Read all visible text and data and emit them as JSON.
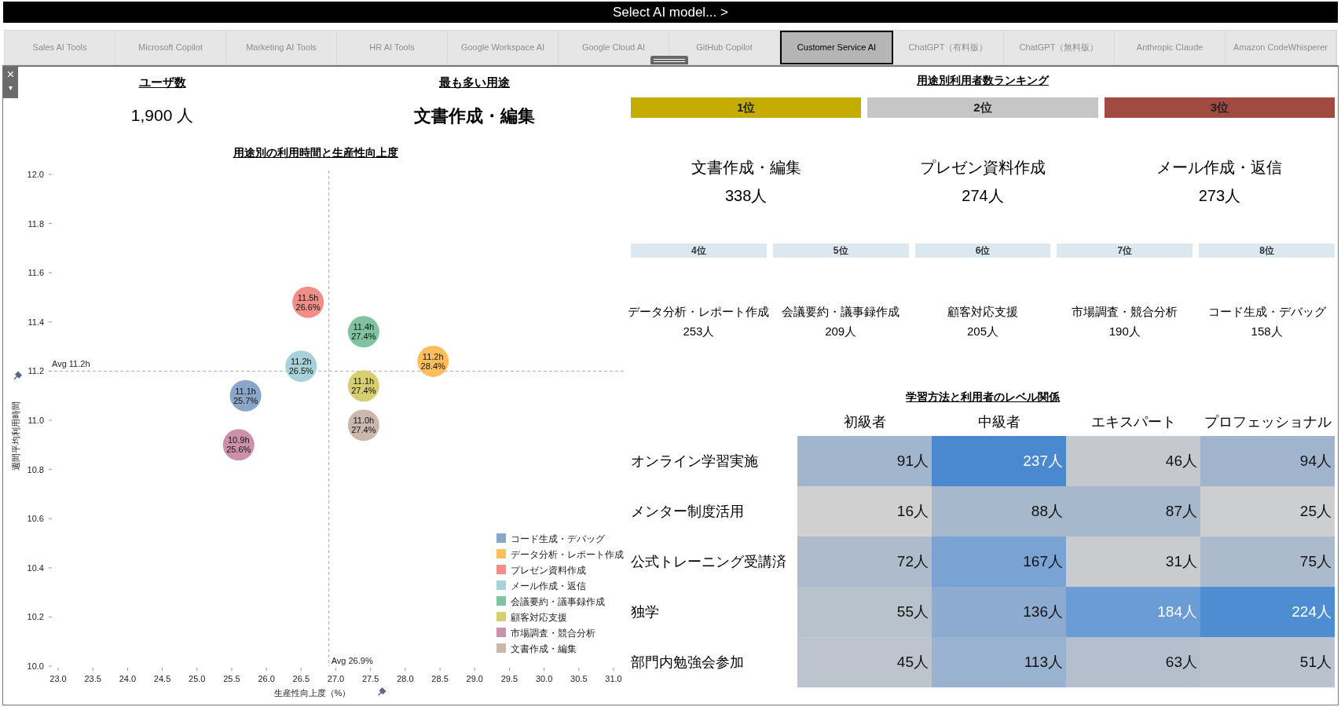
{
  "header": {
    "title": "Select AI model... >"
  },
  "tabs": [
    {
      "label": "Sales AI Tools",
      "selected": false
    },
    {
      "label": "Microsoft Copilot",
      "selected": false
    },
    {
      "label": "Marketing AI Tools",
      "selected": false
    },
    {
      "label": "HR AI Tools",
      "selected": false
    },
    {
      "label": "Google Workspace AI",
      "selected": false
    },
    {
      "label": "Google Cloud AI",
      "selected": false
    },
    {
      "label": "GitHub Copilot",
      "selected": false
    },
    {
      "label": "Customer Service AI",
      "selected": true
    },
    {
      "label": "ChatGPT（有料版）",
      "selected": false
    },
    {
      "label": "ChatGPT（無料版）",
      "selected": false
    },
    {
      "label": "Anthropic Claude",
      "selected": false
    },
    {
      "label": "Amazon CodeWhisperer",
      "selected": false
    }
  ],
  "close_button": {
    "label": "×",
    "menu": "▾"
  },
  "kpis": [
    {
      "label": "ユーザ数",
      "value": "1,900 人",
      "bold": false
    },
    {
      "label": "最も多い用途",
      "value": "文書作成・編集",
      "bold": true
    }
  ],
  "scatter": {
    "title": "用途別の利用時間と生産性向上度",
    "chart_data": {
      "type": "scatter",
      "xlabel": "生産性向上度（%）",
      "ylabel": "週間平均利用時間",
      "xlim": [
        23,
        31
      ],
      "ylim": [
        10,
        12
      ],
      "xticks": [
        {
          "value": 23,
          "label": "23.0"
        },
        {
          "value": 23.5,
          "label": "23.5"
        },
        {
          "value": 24,
          "label": "24.0"
        },
        {
          "value": 24.5,
          "label": "24.5"
        },
        {
          "value": 25,
          "label": "25.0"
        },
        {
          "value": 25.5,
          "label": "25.5"
        },
        {
          "value": 26,
          "label": "26.0"
        },
        {
          "value": 26.5,
          "label": "26.5"
        },
        {
          "value": 27,
          "label": "27.0"
        },
        {
          "value": 27.5,
          "label": "27.5"
        },
        {
          "value": 28,
          "label": "28.0"
        },
        {
          "value": 28.5,
          "label": "28.5"
        },
        {
          "value": 29,
          "label": "29.0"
        },
        {
          "value": 29.5,
          "label": "29.5"
        },
        {
          "value": 30,
          "label": "30.0"
        },
        {
          "value": 30.5,
          "label": "30.5"
        },
        {
          "value": 31,
          "label": "31.0"
        }
      ],
      "yticks": [
        {
          "value": 10,
          "label": "10.0"
        },
        {
          "value": 10.2,
          "label": "10.2"
        },
        {
          "value": 10.4,
          "label": "10.4"
        },
        {
          "value": 10.6,
          "label": "10.6"
        },
        {
          "value": 10.8,
          "label": "10.8"
        },
        {
          "value": 11,
          "label": "11.0"
        },
        {
          "value": 11.2,
          "label": "11.2"
        },
        {
          "value": 11.4,
          "label": "11.4"
        },
        {
          "value": 11.6,
          "label": "11.6"
        },
        {
          "value": 11.8,
          "label": "11.8"
        },
        {
          "value": 12,
          "label": "12.0"
        }
      ],
      "series": [
        {
          "name": "コード生成・デバッグ",
          "color": "#8aa6c9",
          "x": [
            25.7
          ],
          "values": [
            11.1
          ],
          "value_labels": [
            "11.1h\n25.7%"
          ]
        },
        {
          "name": "データ分析・レポート作成",
          "color": "#ffbe5e",
          "x": [
            28.4
          ],
          "values": [
            11.24
          ],
          "value_labels": [
            "11.2h\n28.4%"
          ]
        },
        {
          "name": "プレゼン資料作成",
          "color": "#f28e88",
          "x": [
            26.6
          ],
          "values": [
            11.48
          ],
          "value_labels": [
            "11.5h\n26.6%"
          ]
        },
        {
          "name": "メール作成・返信",
          "color": "#a8d1d9",
          "x": [
            26.5
          ],
          "values": [
            11.22
          ],
          "value_labels": [
            "11.2h\n26.5%"
          ]
        },
        {
          "name": "会議要約・議事録作成",
          "color": "#80c3a0",
          "x": [
            27.4
          ],
          "values": [
            11.36
          ],
          "value_labels": [
            "11.4h\n27.4%"
          ]
        },
        {
          "name": "顧客対応支援",
          "color": "#d5cf70",
          "x": [
            27.4
          ],
          "values": [
            11.14
          ],
          "value_labels": [
            "11.1h\n27.4%"
          ]
        },
        {
          "name": "市場調査・競合分析",
          "color": "#cd90a9",
          "x": [
            25.6
          ],
          "values": [
            10.9
          ],
          "value_labels": [
            "10.9h\n25.6%"
          ]
        },
        {
          "name": "文書作成・編集",
          "color": "#cab8ad",
          "x": [
            27.4
          ],
          "values": [
            10.98
          ],
          "value_labels": [
            "11.0h\n27.4%"
          ]
        }
      ],
      "legend": "lower right",
      "ref_lines": [
        {
          "axis": "y",
          "value": 11.2,
          "label": "Avg 11.2h"
        },
        {
          "axis": "x",
          "value": 26.9,
          "label": "Avg 26.9%"
        }
      ]
    }
  },
  "ranking": {
    "title": "用途別利用者数ランキング",
    "top": [
      {
        "rank": "1位",
        "name": "文書作成・編集",
        "count": "338人",
        "color": "#c4ad00"
      },
      {
        "rank": "2位",
        "name": "プレゼン資料作成",
        "count": "274人",
        "color": "#c6c6c6"
      },
      {
        "rank": "3位",
        "name": "メール作成・返信",
        "count": "273人",
        "color": "#a04a42"
      }
    ],
    "others": [
      {
        "rank": "4位",
        "name": "データ分析・レポート作成",
        "count": "253人"
      },
      {
        "rank": "5位",
        "name": "会議要約・議事録作成",
        "count": "209人"
      },
      {
        "rank": "6位",
        "name": "顧客対応支援",
        "count": "205人"
      },
      {
        "rank": "7位",
        "name": "市場調査・競合分析",
        "count": "190人"
      },
      {
        "rank": "8位",
        "name": "コード生成・デバッグ",
        "count": "158人"
      }
    ]
  },
  "heatmap": {
    "title": "学習方法と利用者のレベル関係",
    "columns": [
      "初級者",
      "中級者",
      "エキスパート",
      "プロフェッショナル"
    ],
    "rows": [
      {
        "label": "オンライン学習実施",
        "cells": [
          {
            "value": "91人",
            "color": "#a1b6cd"
          },
          {
            "value": "237人",
            "color": "#4a89d0"
          },
          {
            "value": "46人",
            "color": "#c5c9cd"
          },
          {
            "value": "94人",
            "color": "#a0b5cd"
          }
        ]
      },
      {
        "label": "メンター制度活用",
        "cells": [
          {
            "value": "16人",
            "color": "#d0d0d0"
          },
          {
            "value": "88人",
            "color": "#a5b8cc"
          },
          {
            "value": "87人",
            "color": "#a6b8cc"
          },
          {
            "value": "25人",
            "color": "#cdcecf"
          }
        ]
      },
      {
        "label": "公式トレーニング受講済",
        "cells": [
          {
            "value": "72人",
            "color": "#adbbcc"
          },
          {
            "value": "167人",
            "color": "#78a3d3"
          },
          {
            "value": "31人",
            "color": "#c9cbce"
          },
          {
            "value": "75人",
            "color": "#abbacc"
          }
        ]
      },
      {
        "label": "独学",
        "cells": [
          {
            "value": "55人",
            "color": "#b8c2cd"
          },
          {
            "value": "136人",
            "color": "#8dabd0"
          },
          {
            "value": "184人",
            "color": "#6a9dd5"
          },
          {
            "value": "224人",
            "color": "#4f8dd2"
          }
        ]
      },
      {
        "label": "部門内勉強会参加",
        "cells": [
          {
            "value": "45人",
            "color": "#bdc4cd"
          },
          {
            "value": "113人",
            "color": "#99b2cf"
          },
          {
            "value": "63人",
            "color": "#b3bfcd"
          },
          {
            "value": "51人",
            "color": "#bac3cd"
          }
        ]
      }
    ]
  }
}
